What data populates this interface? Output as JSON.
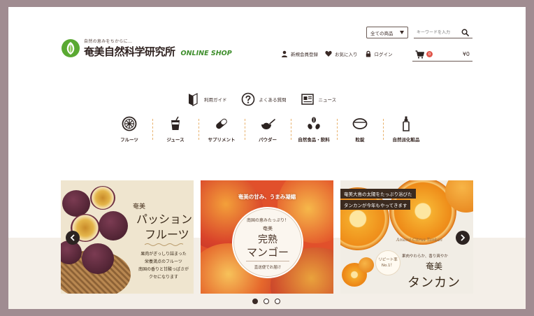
{
  "header": {
    "logo_tagline": "自然の恵みをちからに…",
    "logo_name": "奄美自然科学研究所",
    "logo_shop": "ONLINE SHOP",
    "category_select": "全ての商品",
    "search_placeholder": "キーワードを入力",
    "links": {
      "register": "新規会員登録",
      "favorites": "お気に入り",
      "login": "ログイン"
    },
    "cart": {
      "count": "0",
      "total": "¥0"
    }
  },
  "info_nav": [
    {
      "label": "利用ガイド",
      "icon": "guide-icon"
    },
    {
      "label": "よくある質問",
      "icon": "question-icon"
    },
    {
      "label": "ニュース",
      "icon": "news-icon"
    }
  ],
  "categories": [
    {
      "label": "フルーツ",
      "icon": "fruit-icon"
    },
    {
      "label": "ジュース",
      "icon": "juice-icon"
    },
    {
      "label": "サプリメント",
      "icon": "capsule-icon"
    },
    {
      "label": "パウダー",
      "icon": "powder-icon"
    },
    {
      "label": "自然食品・飲料",
      "icon": "beans-icon"
    },
    {
      "label": "粒錠",
      "icon": "tablet-icon"
    },
    {
      "label": "自然派化粧品",
      "icon": "cosmetic-bottle-icon"
    }
  ],
  "slides": {
    "passion": {
      "small": "奄美",
      "title1": "パッション",
      "title2": "フルーツ",
      "body1": "果肉がぎっしり詰まった",
      "body2": "栄養満点のフルーツ",
      "body3": "南国の香りと甘酸っぱさが",
      "body4": "クセになります"
    },
    "mango": {
      "top": "奄美の甘み、うまみ凝縮",
      "c1": "南国の恵みたっぷり！",
      "c2": "奄美",
      "c3": "完熟",
      "c4": "マンゴー",
      "c5": "直送便でお届け"
    },
    "tankan": {
      "banner1": "奄美大島の太陽をたっぷり浴びた",
      "banner2": "タンカンが今年もやってきます",
      "script": "Amami Citrus Tankan",
      "repeat1": "リピート率",
      "repeat2": "No.1！",
      "sub": "果肉やわらか、香り爽やか",
      "amami": "奄美",
      "title": "タンカン"
    }
  },
  "carousel": {
    "pages": 3,
    "active": 1
  },
  "colors": {
    "accent_green": "#3e8e2c",
    "badge_red": "#e0554a",
    "divider_orange": "#e8b06a",
    "dark": "#2c2321"
  }
}
